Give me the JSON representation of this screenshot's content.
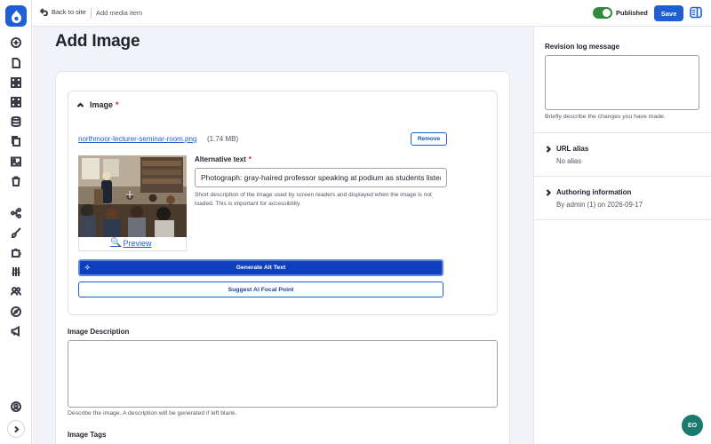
{
  "topbar": {
    "back_label": "Back to site",
    "breadcrumb": "Add media item",
    "status_label": "Published",
    "status_on": true,
    "save_label": "Save"
  },
  "page": {
    "title": "Add Image"
  },
  "image_field": {
    "label": "Image",
    "required_marker": "*",
    "file_name": "northmoor-lecturer-seminar-room.png",
    "file_size": "(1.74 MB)",
    "remove_label": "Remove",
    "preview_label": "Preview",
    "alt_label": "Alternative text",
    "alt_required_marker": "*",
    "alt_value": "Photograph: gray-haired professor speaking at podium as students listen",
    "alt_help": "Short description of the image used by screen readers and displayed when the image is not loaded. This is important for accessibility.",
    "generate_alt_label": "Generate Alt Text",
    "focal_point_label": "Suggest AI Focal Point"
  },
  "description_field": {
    "label": "Image Description",
    "value": "",
    "help": "Describe the image. A description will be generated if left blank."
  },
  "tags_field": {
    "label": "Image Tags"
  },
  "sidebar": {
    "revision_label": "Revision log message",
    "revision_value": "",
    "revision_help": "Briefly describe the changes you have made.",
    "url_alias_label": "URL alias",
    "url_alias_value": "No alias",
    "authoring_label": "Authoring information",
    "authoring_value": "By admin (1) on 2026-09-17"
  },
  "icons": {
    "rail": [
      "plus-circle-icon",
      "document-icon",
      "grid-icon",
      "blocks-icon",
      "database-icon",
      "copy-icon",
      "image-icon",
      "trash-icon",
      "structure-icon",
      "brush-icon",
      "puzzle-icon",
      "sliders-icon",
      "users-icon",
      "compass-icon",
      "megaphone-icon",
      "user-icon",
      "chevron-right-icon"
    ]
  },
  "colors": {
    "primary": "#1f5fd1",
    "toggle_on": "#2f8a3b",
    "required": "#d72222",
    "chat": "#1a7a6e"
  },
  "chat": {
    "label": "EO"
  }
}
